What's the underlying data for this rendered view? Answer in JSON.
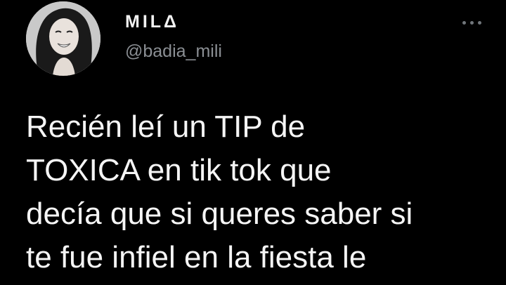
{
  "tweet": {
    "author": {
      "display_name": "MILΔ",
      "username": "@badia_mili",
      "avatar_icon": "avatar-photo"
    },
    "more_icon": "more-horizontal-icon",
    "text_lines": [
      "Recién leí un TIP de",
      "TOXICA en tik tok que",
      "decía que si queres saber si",
      "te fue infiel en la fiesta le"
    ]
  },
  "colors": {
    "background": "#000000",
    "text_primary": "#f5f5f5",
    "text_secondary": "#8b8f94"
  }
}
